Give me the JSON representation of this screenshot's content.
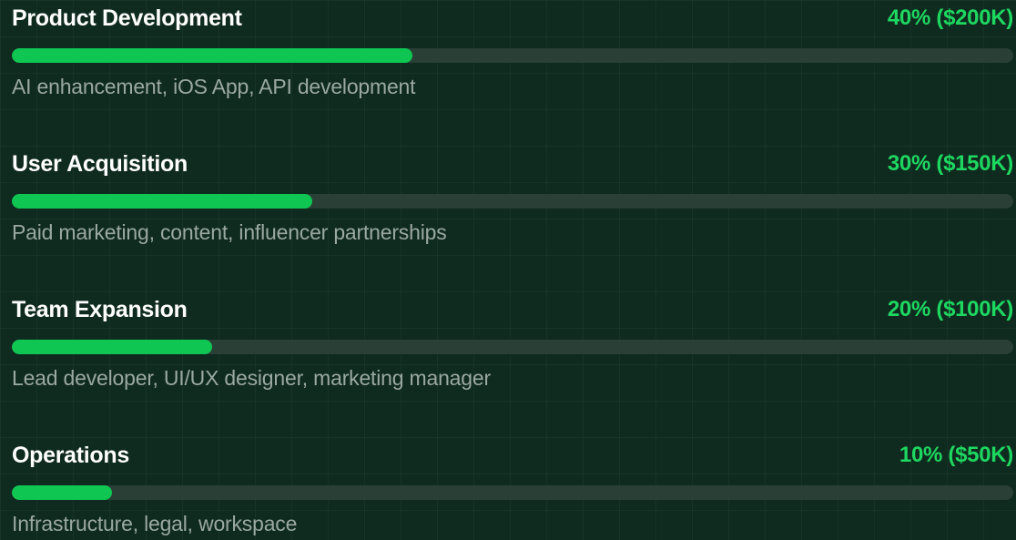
{
  "allocations": [
    {
      "title": "Product Development",
      "amount": "40% ($200K)",
      "percent": 40,
      "description": "AI enhancement, iOS App, API development"
    },
    {
      "title": "User Acquisition",
      "amount": "30% ($150K)",
      "percent": 30,
      "description": "Paid marketing, content, influencer partnerships"
    },
    {
      "title": "Team Expansion",
      "amount": "20% ($100K)",
      "percent": 20,
      "description": "Lead developer, UI/UX designer, marketing manager"
    },
    {
      "title": "Operations",
      "amount": "10% ($50K)",
      "percent": 10,
      "description": "Infrastructure, legal, workspace"
    }
  ],
  "colors": {
    "background": "#0f2a1f",
    "accent": "#0fc653",
    "track": "#2a3f35",
    "title": "#ffffff",
    "description": "#9aa9a2"
  }
}
